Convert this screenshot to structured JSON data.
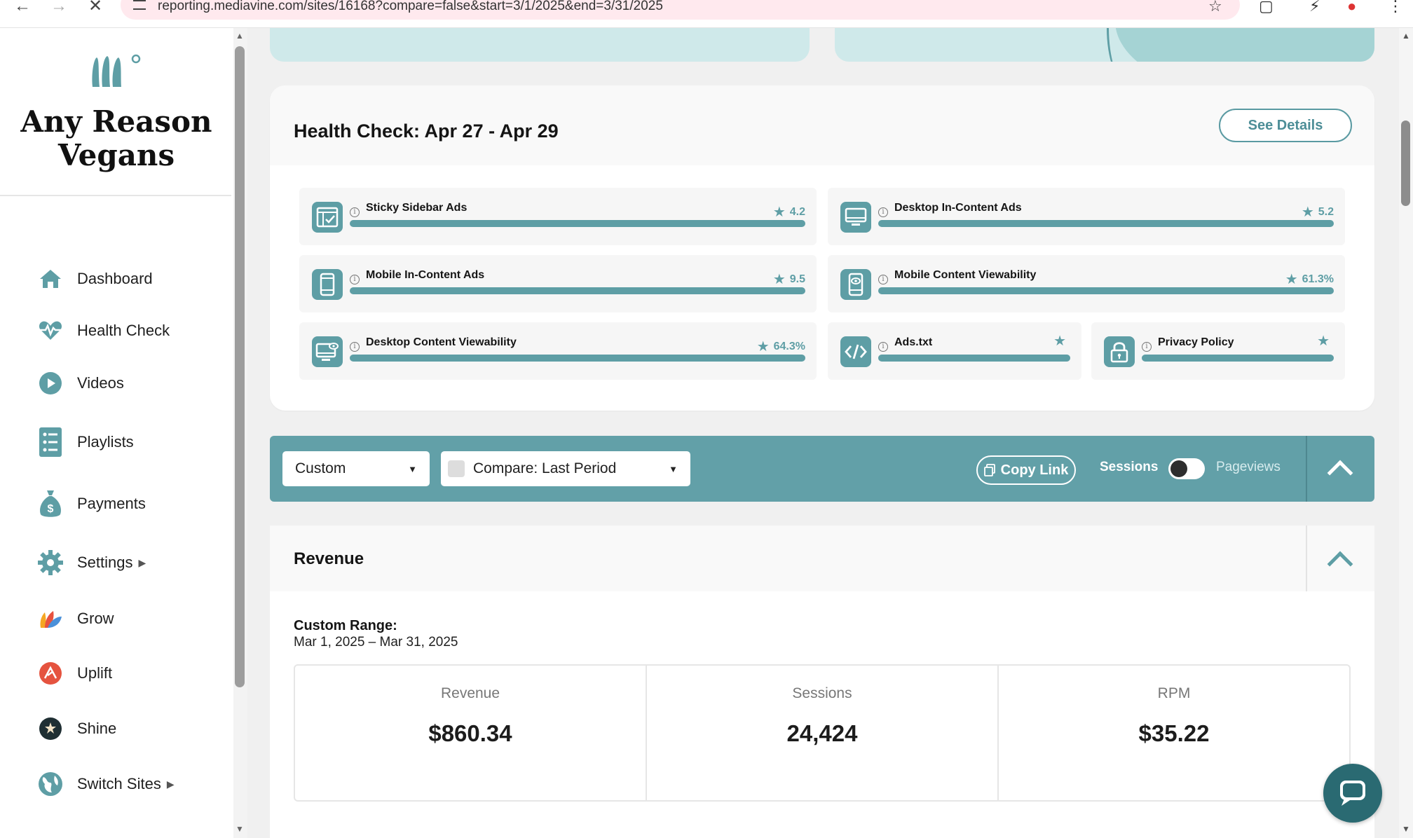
{
  "browser": {
    "url": "reporting.mediavine.com/sites/16168?compare=false&start=3/1/2025&end=3/31/2025"
  },
  "sidebar": {
    "site_name_line1": "Any Reason",
    "site_name_line2": "Vegans",
    "items": [
      {
        "label": "Dashboard",
        "icon": "home-icon"
      },
      {
        "label": "Health Check",
        "icon": "heart-pulse-icon"
      },
      {
        "label": "Videos",
        "icon": "play-icon"
      },
      {
        "label": "Playlists",
        "icon": "list-icon"
      },
      {
        "label": "Payments",
        "icon": "money-bag-icon"
      },
      {
        "label": "Settings",
        "icon": "gear-icon"
      },
      {
        "label": "Grow",
        "icon": "grow-icon"
      },
      {
        "label": "Uplift",
        "icon": "uplift-icon"
      },
      {
        "label": "Shine",
        "icon": "shine-icon"
      },
      {
        "label": "Switch Sites",
        "icon": "globe-icon"
      }
    ]
  },
  "health_check": {
    "title": "Health Check: Apr 27 - Apr 29",
    "see_details_label": "See Details",
    "metrics": [
      {
        "label": "Sticky Sidebar Ads",
        "score": "4.2",
        "icon": "sidebar-ad-icon"
      },
      {
        "label": "Desktop In-Content Ads",
        "score": "5.2",
        "icon": "desktop-icon"
      },
      {
        "label": "Mobile In-Content Ads",
        "score": "9.5",
        "icon": "mobile-icon"
      },
      {
        "label": "Mobile Content Viewability",
        "score": "61.3%",
        "icon": "mobile-eye-icon"
      },
      {
        "label": "Desktop Content Viewability",
        "score": "64.3%",
        "icon": "desktop-eye-icon"
      },
      {
        "label": "Ads.txt",
        "score": "",
        "icon": "code-icon"
      },
      {
        "label": "Privacy Policy",
        "score": "",
        "icon": "lock-icon"
      }
    ]
  },
  "toolbar": {
    "range_select": "Custom",
    "compare_select": "Compare: Last Period",
    "copy_link_label": "Copy Link",
    "toggle_left": "Sessions",
    "toggle_right": "Pageviews"
  },
  "revenue": {
    "title": "Revenue",
    "range_label": "Custom Range:",
    "range_value": "Mar 1, 2025 – Mar 31, 2025",
    "stats": [
      {
        "label": "Revenue",
        "value": "$860.34"
      },
      {
        "label": "Sessions",
        "value": "24,424"
      },
      {
        "label": "RPM",
        "value": "$35.22"
      }
    ]
  },
  "colors": {
    "accent": "#5e9ea5",
    "toolbar": "#62a0a8"
  }
}
